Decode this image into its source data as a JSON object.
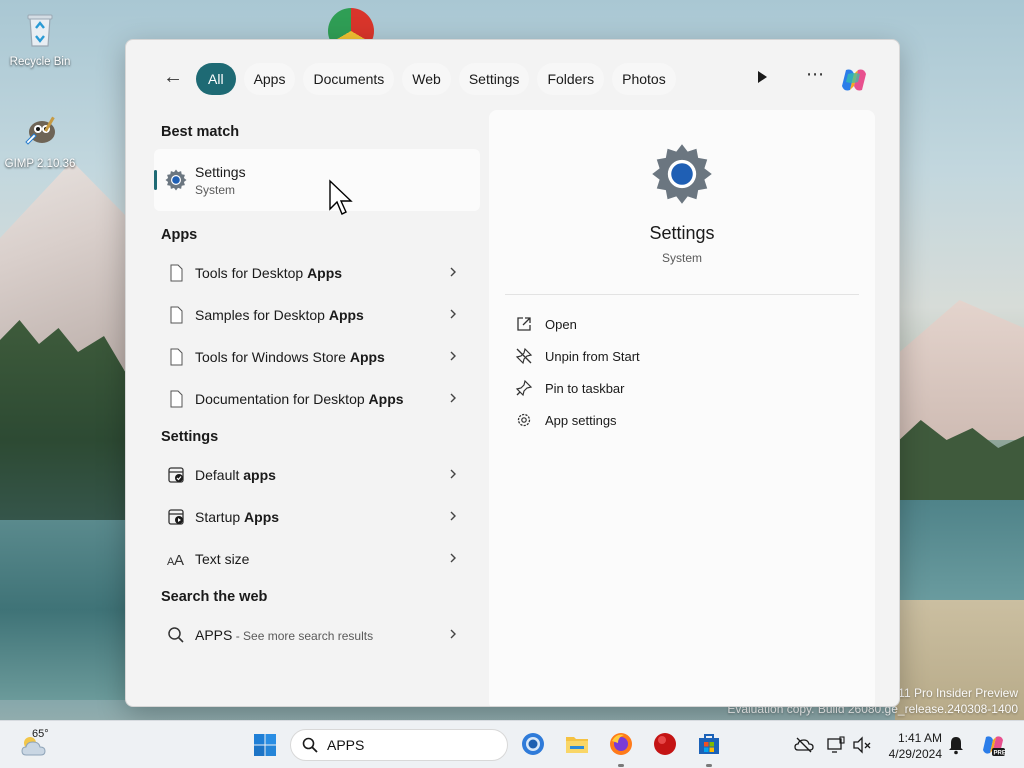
{
  "desktop": {
    "icons": [
      {
        "label": "Recycle Bin",
        "icon": "recycle-bin-icon"
      },
      {
        "label": "GIMP 2.10.36",
        "icon": "gimp-icon"
      }
    ],
    "watermark": {
      "line1": "11 Pro Insider Preview",
      "line2": "Evaluation copy. Build 26080.ge_release.240308-1400"
    }
  },
  "search": {
    "back_label": "←",
    "filters": [
      "All",
      "Apps",
      "Documents",
      "Web",
      "Settings",
      "Folders",
      "Photos"
    ],
    "active_filter": "All",
    "more_label": "⋯",
    "best_match": {
      "heading": "Best match",
      "title": "Settings",
      "subtitle": "System"
    },
    "apps": {
      "heading": "Apps",
      "items": [
        {
          "prefix": "Tools for Desktop ",
          "bold": "Apps"
        },
        {
          "prefix": "Samples for Desktop ",
          "bold": "Apps"
        },
        {
          "prefix": "Tools for Windows Store ",
          "bold": "Apps"
        },
        {
          "prefix": "Documentation for Desktop ",
          "bold": "Apps"
        }
      ]
    },
    "settings": {
      "heading": "Settings",
      "items": [
        {
          "prefix": "Default ",
          "bold": "apps"
        },
        {
          "prefix": "Startup ",
          "bold": "Apps"
        },
        {
          "prefix": "Text size",
          "bold": ""
        }
      ]
    },
    "web": {
      "heading": "Search the web",
      "query": "APPS",
      "suffix": " - See more search results"
    },
    "preview": {
      "title": "Settings",
      "subtitle": "System",
      "actions": [
        {
          "label": "Open",
          "icon": "open-external-icon"
        },
        {
          "label": "Unpin from Start",
          "icon": "unpin-icon"
        },
        {
          "label": "Pin to taskbar",
          "icon": "pin-icon"
        },
        {
          "label": "App settings",
          "icon": "gear-icon"
        }
      ]
    }
  },
  "taskbar": {
    "weather_temp": "65°",
    "search_value": "APPS",
    "time": "1:41 AM",
    "date": "4/29/2024"
  },
  "colors": {
    "accent": "#1e6a74",
    "settings_gear": "#6b7680",
    "settings_center": "#1f5fb4"
  }
}
